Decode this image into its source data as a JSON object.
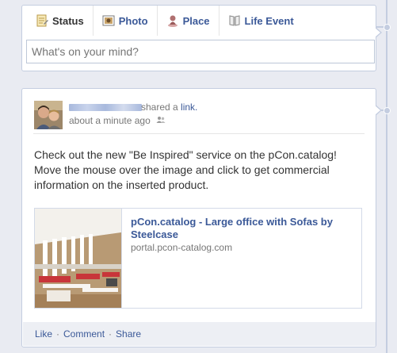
{
  "composer": {
    "tabs": [
      {
        "label": "Status",
        "icon": "status-icon",
        "active": true
      },
      {
        "label": "Photo",
        "icon": "photo-icon",
        "active": false
      },
      {
        "label": "Place",
        "icon": "place-icon",
        "active": false
      },
      {
        "label": "Life Event",
        "icon": "life-event-icon",
        "active": false
      }
    ],
    "placeholder": "What's on your mind?"
  },
  "story": {
    "author_name": "",
    "shared_text": "shared a ",
    "shared_link": "link.",
    "time": "about a minute ago",
    "privacy_icon": "friends-icon",
    "message": "Check out the new \"Be Inspired\" service on the pCon.catalog! Move the mouse over the image and click to get commercial information on the inserted product.",
    "attachment": {
      "title": "pCon.catalog - Large office with Sofas by Steelcase",
      "domain": "portal.pcon-catalog.com"
    },
    "actions": {
      "like": "Like",
      "comment": "Comment",
      "share": "Share",
      "separator": "·"
    }
  },
  "colors": {
    "link": "#3b5998",
    "background": "#e9ebf2",
    "border": "#c4cde0",
    "actions_bg": "#edeff4"
  }
}
